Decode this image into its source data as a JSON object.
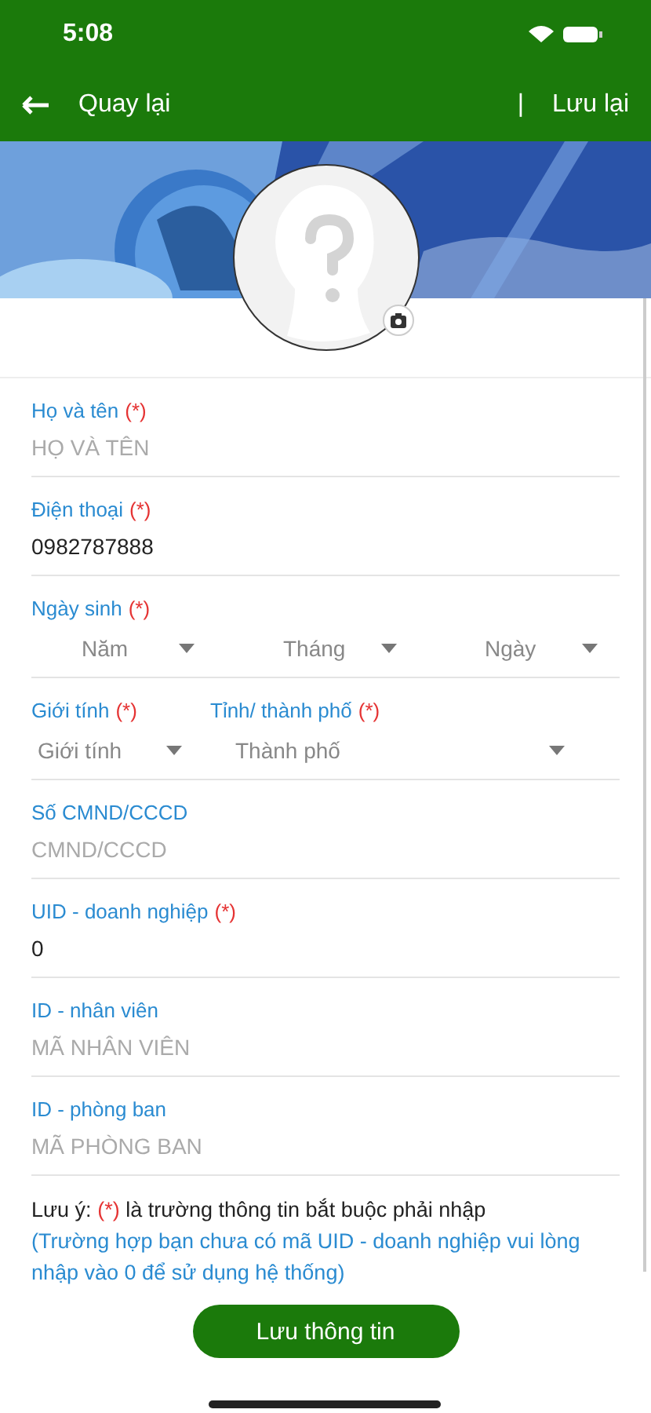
{
  "status_bar": {
    "time": "5:08"
  },
  "nav": {
    "back_label": "Quay lại",
    "separator": "|",
    "save_label": "Lưu lại"
  },
  "fields": [
    {
      "kind": "text",
      "label": "Họ và tên",
      "required_mark": "(*)",
      "placeholder": "HỌ VÀ TÊN"
    },
    {
      "kind": "text",
      "label": "Điện thoại",
      "required_mark": "(*)",
      "value": "0982787888"
    },
    {
      "kind": "date",
      "label": "Ngày sinh",
      "required_mark": "(*)",
      "selects": [
        "Năm",
        "Tháng",
        "Ngày"
      ]
    },
    {
      "kind": "pair",
      "columns": [
        {
          "label": "Giới tính",
          "required_mark": "(*)",
          "select": "Giới tính"
        },
        {
          "label": "Tỉnh/ thành phố",
          "required_mark": "(*)",
          "select": "Thành phố"
        }
      ]
    },
    {
      "kind": "text",
      "label": "Số CMND/CCCD",
      "placeholder": "CMND/CCCD"
    },
    {
      "kind": "text",
      "label": "UID - doanh nghiệp",
      "required_mark": "(*)",
      "value": "0"
    },
    {
      "kind": "text",
      "label": "ID - nhân viên",
      "placeholder": "MÃ NHÂN VIÊN"
    },
    {
      "kind": "text",
      "label": "ID - phòng ban",
      "placeholder": "MÃ PHÒNG BAN"
    }
  ],
  "note": {
    "prefix": "Lưu ý:",
    "mark": "(*)",
    "text": "là trường thông tin bắt buộc phải nhập",
    "hint": "(Trường hợp bạn chưa có mã UID - doanh nghiệp vui lòng nhập vào 0 để sử dụng hệ thống)"
  },
  "submit_label": "Lưu thông tin"
}
